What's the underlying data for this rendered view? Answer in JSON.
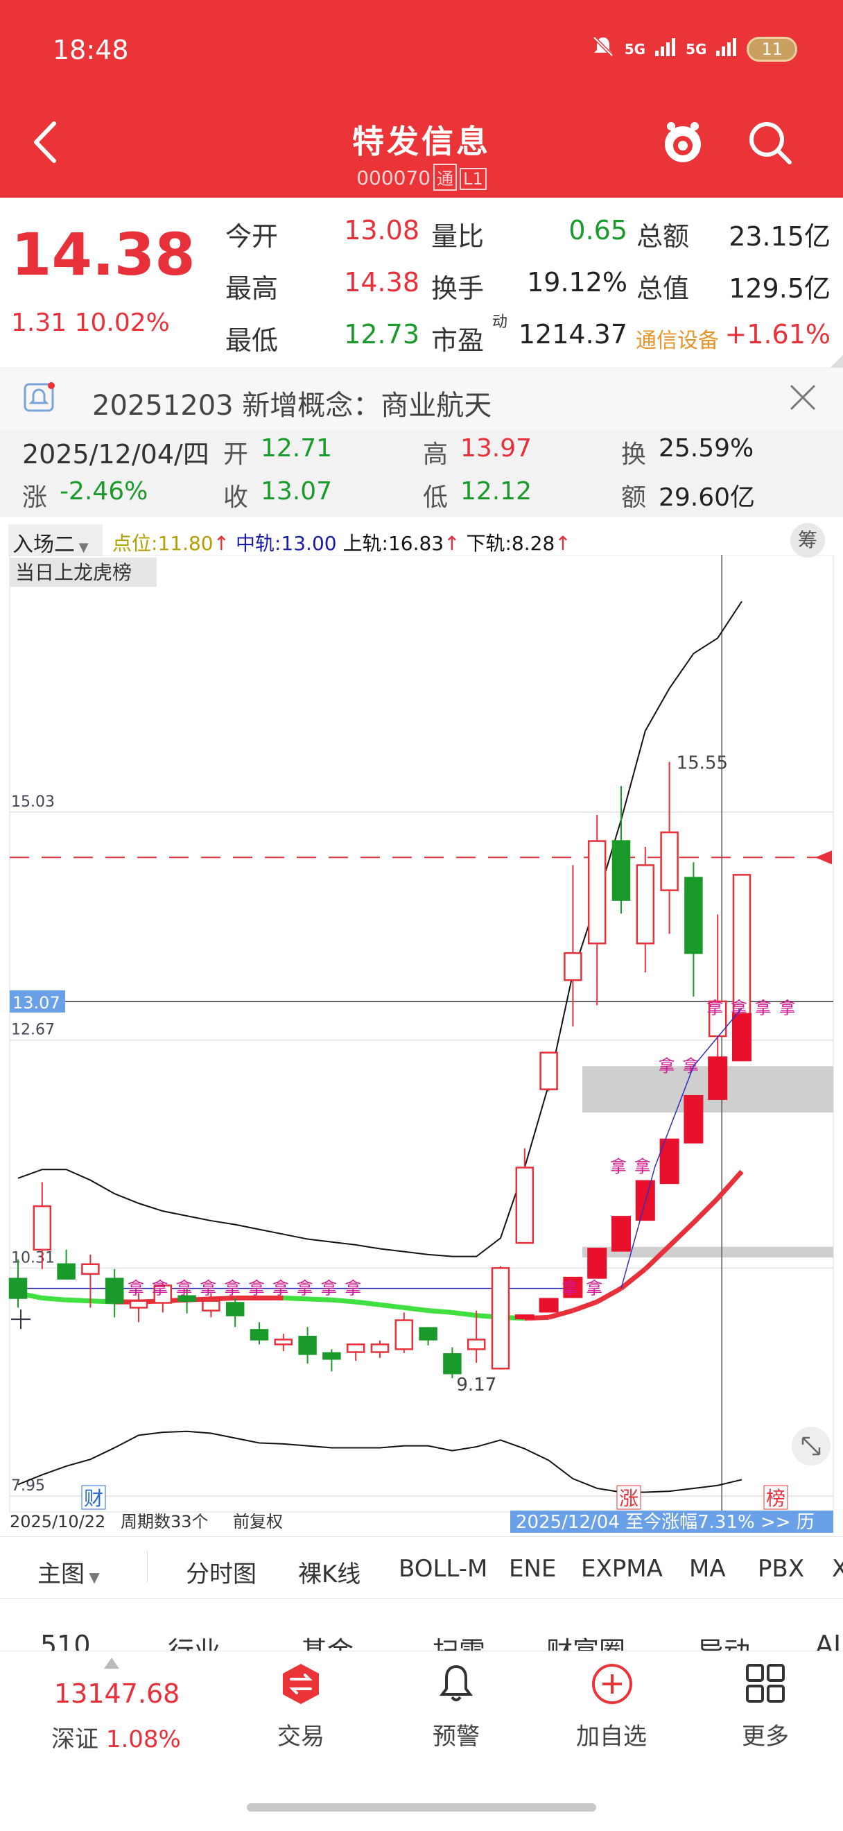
{
  "status": {
    "time": "18:48",
    "sig1": "5G",
    "sig2": "5G",
    "battery": "11"
  },
  "header": {
    "title": "特发信息",
    "code": "000070",
    "tag1": "通",
    "tag2": "L1"
  },
  "quote": {
    "price": "14.38",
    "change": "1.31",
    "change_pct": "10.02%",
    "rows": [
      {
        "l1": "今开",
        "v1": "13.08",
        "l2": "量比",
        "v2": "0.65",
        "l3": "总额",
        "v3": "23.15亿"
      },
      {
        "l1": "最高",
        "v1": "14.38",
        "l2": "换手",
        "v2": "19.12%",
        "l3": "总值",
        "v3": "129.5亿"
      },
      {
        "l1": "最低",
        "v1": "12.73",
        "l2": "市盈",
        "v2": "1214.37",
        "l3": "通信设备",
        "v3": "+1.61%"
      }
    ],
    "pe_sup": "动"
  },
  "notice": {
    "text": "20251203 新增概念：商业航天"
  },
  "day": {
    "date": "2025/12/04/四",
    "open_label": "开",
    "open": "12.71",
    "high_label": "高",
    "high": "13.97",
    "turn_label": "换",
    "turn": "25.59%",
    "chg_label": "涨",
    "chg": "-2.46%",
    "close_label": "收",
    "close": "13.07",
    "low_label": "低",
    "low": "12.12",
    "amt_label": "额",
    "amt": "29.60亿"
  },
  "indicator": {
    "name": "入场二",
    "dw_label": "点位:",
    "dw": "11.80",
    "mid_label": "中轨:",
    "mid": "13.00",
    "up_label": "上轨:",
    "up": "16.83",
    "low_label": "下轨:",
    "low": "8.28",
    "chip_btn": "筹"
  },
  "chart_data": {
    "type": "candlestick",
    "title": "",
    "overlay_label": "当日上龙虎榜",
    "y_ticks": [
      "15.03",
      "12.67",
      "10.31",
      "7.95"
    ],
    "crosshair_price": "13.07",
    "max_label": "15.55",
    "min_label": "9.17",
    "x_start": "2025/10/22",
    "period_count": "周期数33个",
    "adjust": "前复权",
    "footer_note": "2025/12/04 至今涨幅7.31% >> 历",
    "markers": {
      "cai": "财",
      "zhang": "涨",
      "bang": "榜"
    },
    "signal_text": "拿",
    "candles": [
      {
        "o": 10.2,
        "h": 10.4,
        "l": 9.9,
        "c": 10.0
      },
      {
        "o": 10.5,
        "h": 11.2,
        "l": 10.3,
        "c": 10.95
      },
      {
        "o": 10.35,
        "h": 10.5,
        "l": 10.2,
        "c": 10.2
      },
      {
        "o": 10.25,
        "h": 10.45,
        "l": 9.9,
        "c": 10.35
      },
      {
        "o": 10.2,
        "h": 10.3,
        "l": 9.8,
        "c": 9.95
      },
      {
        "o": 9.9,
        "h": 10.05,
        "l": 9.75,
        "c": 9.97
      },
      {
        "o": 9.95,
        "h": 10.15,
        "l": 9.85,
        "c": 10.13
      },
      {
        "o": 10.02,
        "h": 10.1,
        "l": 9.84,
        "c": 9.97
      },
      {
        "o": 9.87,
        "h": 10.05,
        "l": 9.8,
        "c": 9.97
      },
      {
        "o": 9.95,
        "h": 10.0,
        "l": 9.7,
        "c": 9.82
      },
      {
        "o": 9.67,
        "h": 9.75,
        "l": 9.52,
        "c": 9.57
      },
      {
        "o": 9.52,
        "h": 9.63,
        "l": 9.45,
        "c": 9.57
      },
      {
        "o": 9.6,
        "h": 9.7,
        "l": 9.32,
        "c": 9.42
      },
      {
        "o": 9.43,
        "h": 9.47,
        "l": 9.24,
        "c": 9.37
      },
      {
        "o": 9.44,
        "h": 9.52,
        "l": 9.35,
        "c": 9.52
      },
      {
        "o": 9.44,
        "h": 9.56,
        "l": 9.38,
        "c": 9.52
      },
      {
        "o": 9.47,
        "h": 9.85,
        "l": 9.43,
        "c": 9.77
      },
      {
        "o": 9.69,
        "h": 9.7,
        "l": 9.51,
        "c": 9.57
      },
      {
        "o": 9.42,
        "h": 9.49,
        "l": 9.17,
        "c": 9.22
      },
      {
        "o": 9.47,
        "h": 9.87,
        "l": 9.33,
        "c": 9.57
      },
      {
        "o": 9.27,
        "h": 10.33,
        "l": 9.26,
        "c": 10.31
      },
      {
        "o": 10.57,
        "h": 11.55,
        "l": 10.57,
        "c": 11.35
      },
      {
        "o": 12.16,
        "h": 12.54,
        "l": 12.14,
        "c": 12.54
      },
      {
        "o": 13.29,
        "h": 14.48,
        "l": 12.81,
        "c": 13.57
      },
      {
        "o": 13.67,
        "h": 15.0,
        "l": 13.03,
        "c": 14.73
      },
      {
        "o": 14.73,
        "h": 15.3,
        "l": 13.98,
        "c": 14.12
      },
      {
        "o": 13.67,
        "h": 14.67,
        "l": 13.37,
        "c": 14.48
      },
      {
        "o": 14.22,
        "h": 15.55,
        "l": 13.77,
        "c": 14.82
      },
      {
        "o": 14.35,
        "h": 14.51,
        "l": 13.12,
        "c": 13.57
      },
      {
        "o": 12.71,
        "h": 13.97,
        "l": 12.12,
        "c": 13.07
      },
      {
        "o": 12.77,
        "h": 14.38,
        "l": 12.73,
        "c": 14.38
      }
    ],
    "upper_band": [
      11.24,
      11.33,
      11.33,
      11.22,
      11.08,
      10.98,
      10.9,
      10.85,
      10.8,
      10.76,
      10.71,
      10.66,
      10.61,
      10.58,
      10.55,
      10.51,
      10.48,
      10.45,
      10.43,
      10.43,
      10.62,
      11.35,
      12.21,
      13.36,
      14.12,
      14.95,
      15.87,
      16.31,
      16.67,
      16.83,
      17.21
    ],
    "lower_band": [
      8.07,
      8.17,
      8.26,
      8.33,
      8.45,
      8.58,
      8.61,
      8.62,
      8.6,
      8.55,
      8.5,
      8.49,
      8.47,
      8.45,
      8.45,
      8.45,
      8.47,
      8.47,
      8.42,
      8.46,
      8.53,
      8.44,
      8.32,
      8.13,
      8.03,
      7.99,
      7.99,
      8.0,
      8.03,
      8.06,
      8.12
    ],
    "ma_line": [
      10.05,
      10.0,
      9.98,
      9.97,
      9.96,
      9.96,
      9.97,
      9.98,
      9.99,
      10.0,
      10.0,
      10.0,
      9.99,
      9.98,
      9.96,
      9.93,
      9.9,
      9.87,
      9.85,
      9.82,
      9.8,
      9.79,
      9.8,
      9.87,
      9.96,
      10.1,
      10.3,
      10.54,
      10.78,
      11.03,
      11.31
    ]
  },
  "tabs": {
    "main": "主图",
    "items": [
      "分时图",
      "裸K线",
      "BOLL-M",
      "ENE",
      "EXPMA",
      "MA",
      "PBX",
      "X"
    ]
  },
  "subtabs": [
    "510",
    "行业",
    "基金",
    "扫雷",
    "财富圈",
    "异动",
    "AI"
  ],
  "bottom": {
    "index_val": "13147.68",
    "index_name": "深证",
    "index_pct": "1.08%",
    "trade": "交易",
    "alert": "预警",
    "add": "加自选",
    "more": "更多"
  },
  "colors": {
    "up": "#e8303a",
    "down": "#1a9a2a",
    "brand": "#ea3438"
  }
}
